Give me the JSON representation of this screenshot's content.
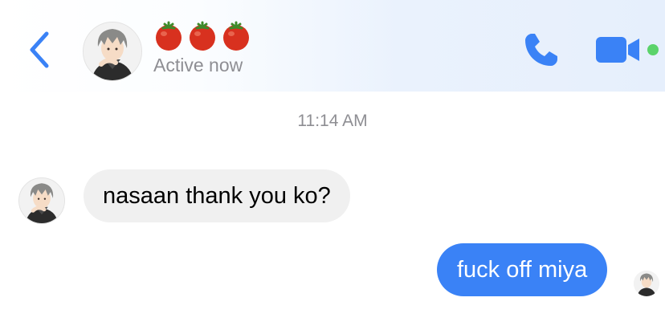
{
  "header": {
    "contact_name_emojis": [
      "🍅",
      "🍅",
      "🍅"
    ],
    "status": "Active now",
    "icons": {
      "back": "chevron-left-icon",
      "call": "phone-icon",
      "video": "video-camera-icon",
      "online": "online-indicator-dot"
    }
  },
  "conversation": {
    "timestamp": "11:14 AM",
    "messages": [
      {
        "direction": "incoming",
        "text": "nasaan thank you ko?"
      },
      {
        "direction": "outgoing",
        "text": "fuck off miya"
      }
    ]
  },
  "colors": {
    "accent": "#3a82f6",
    "incoming_bubble": "#f0f0f0",
    "online": "#5bd36a",
    "muted_text": "#8e8e93"
  }
}
